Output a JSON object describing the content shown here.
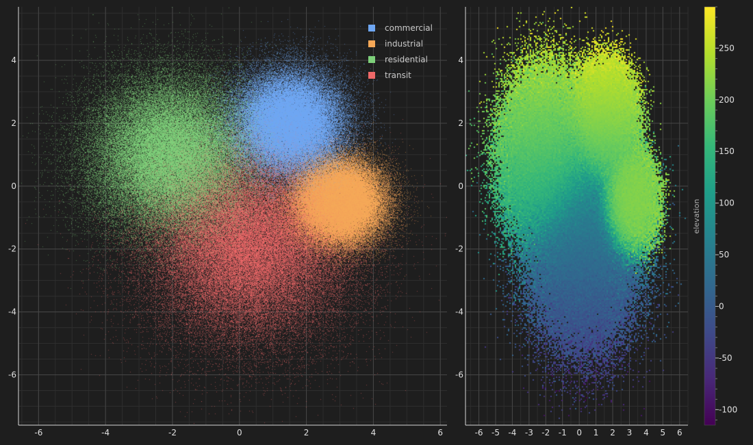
{
  "chart_data": [
    {
      "type": "scatter",
      "title": "",
      "xlabel": "",
      "ylabel": "",
      "xlim": [
        -6.6,
        6.2
      ],
      "ylim": [
        -7.6,
        5.7
      ],
      "xticks": [
        -6,
        -4,
        -2,
        0,
        2,
        4,
        6
      ],
      "yticks": [
        -6,
        -4,
        -2,
        0,
        2,
        4
      ],
      "grid": true,
      "legend_position": "top-right",
      "series": [
        {
          "name": "commercial",
          "color": "#6ea6f2",
          "center": [
            1.5,
            2.0
          ],
          "spread": 0.8
        },
        {
          "name": "industrial",
          "color": "#f5a857",
          "center": [
            3.0,
            -0.5
          ],
          "spread": 0.65
        },
        {
          "name": "residential",
          "color": "#7ed07a",
          "center": [
            -2.0,
            1.0
          ],
          "spread": 1.2
        },
        {
          "name": "transit",
          "color": "#ee6868",
          "center": [
            0.3,
            -1.8
          ],
          "spread": 1.5
        }
      ]
    },
    {
      "type": "heatmap",
      "title": "",
      "xlabel": "",
      "ylabel": "",
      "xlim": [
        -6.8,
        6.5
      ],
      "ylim": [
        -7.6,
        5.7
      ],
      "xticks": [
        -6,
        -5,
        -4,
        -3,
        -2,
        -1,
        0,
        1,
        2,
        3,
        4,
        5,
        6
      ],
      "yticks": [
        -6,
        -4,
        -2,
        0,
        2,
        4
      ],
      "grid": true,
      "colorbar": {
        "label": "elevation",
        "range": [
          -115,
          290
        ],
        "ticks": [
          -100,
          -50,
          0,
          50,
          100,
          150,
          200,
          250
        ],
        "colormap": "viridis"
      }
    }
  ]
}
